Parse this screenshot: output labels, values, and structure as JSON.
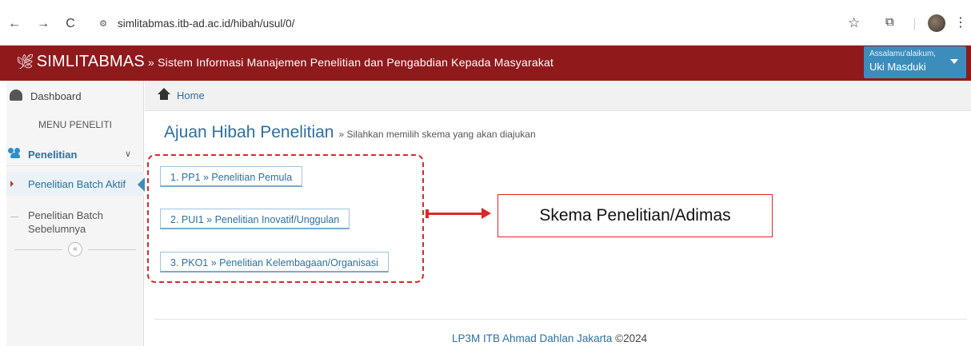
{
  "browser": {
    "url": "simlitabmas.itb-ad.ac.id/hibah/usul/0/",
    "back_icon": "←",
    "forward_icon": "→",
    "reload_icon": "C",
    "star_icon": "☆",
    "extensions_icon": "⧉",
    "menu_icon": "⋮",
    "site_info_icon": "⚙"
  },
  "header": {
    "brand": "SIMLITABMAS",
    "separator": " » ",
    "subtitle": "Sistem Informasi Manajemen Penelitian dan Pengabdian Kepada Masyarakat",
    "user_greeting": "Assalamu'alaikum,",
    "user_name": "Uki Masduki",
    "brand_color": "#8f1a1c",
    "user_box_color": "#3c8dbc"
  },
  "sidebar": {
    "dashboard": "Dashboard",
    "menu_header": "MENU PENELITI",
    "penelitian": "Penelitian",
    "active_item": "Penelitian Batch Aktif",
    "previous_item": "Penelitian Batch Sebelumnya",
    "collapse_icon": "«"
  },
  "breadcrumb": {
    "home": "Home"
  },
  "main": {
    "title": "Ajuan Hibah Penelitian",
    "subtitle": "» Silahkan memilih skema yang akan diajukan",
    "schemes": [
      {
        "label": "1. PP1 » Penelitian Pemula"
      },
      {
        "label": "2. PUI1 » Penelitian Inovatif/Unggulan"
      },
      {
        "label": "3. PKO1 » Penelitian Kelembagaan/Organisasi"
      }
    ]
  },
  "annotation": {
    "callout": "Skema Penelitian/Adimas",
    "color": "#e0262b"
  },
  "footer": {
    "org": "LP3M ITB Ahmad Dahlan Jakarta",
    "copyright": "©2024"
  }
}
